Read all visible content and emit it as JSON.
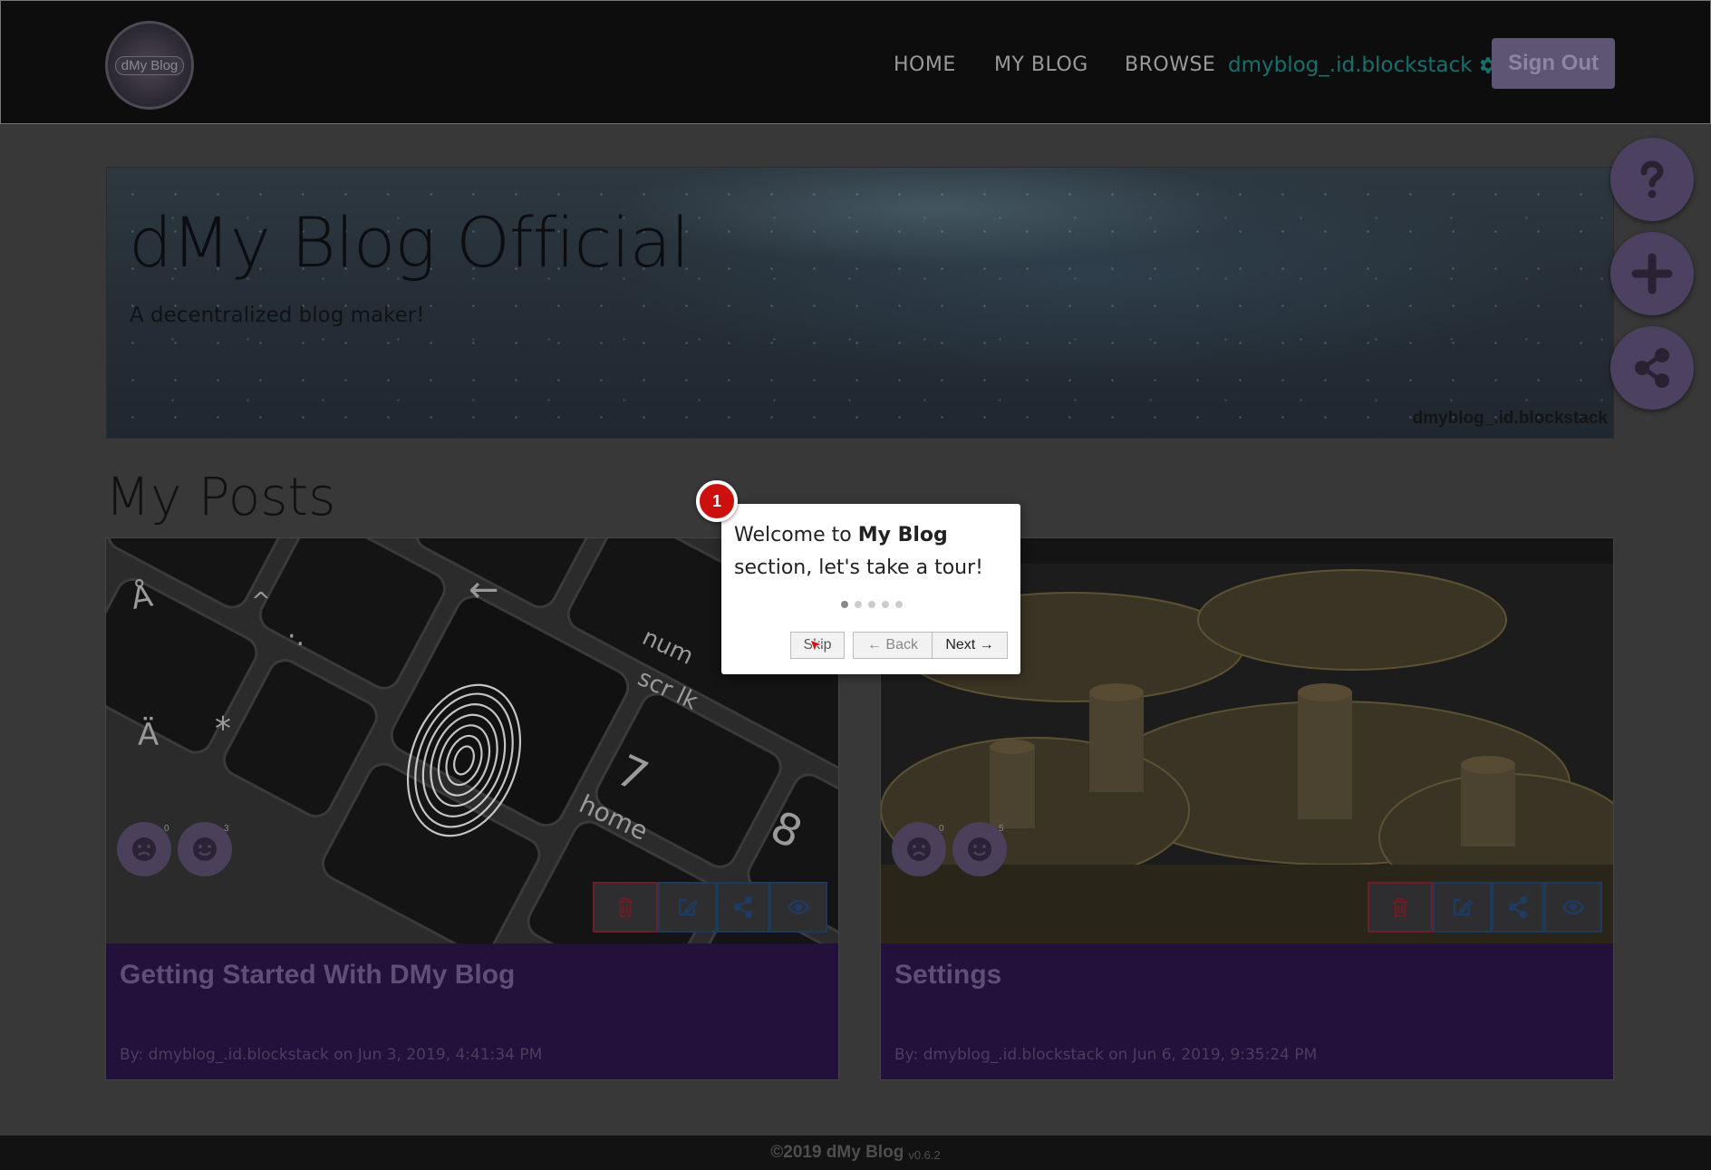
{
  "navbar": {
    "logo_text": "dMy Blog",
    "links": [
      "HOME",
      "MY BLOG",
      "BROWSE"
    ],
    "username": "dmyblog_.id.blockstack",
    "sign_out": "Sign Out"
  },
  "hero": {
    "title": "dMy Blog Official",
    "subtitle": "A decentralized blog maker!",
    "author": "dmyblog_.id.blockstack"
  },
  "fab": {
    "icons": [
      "question-icon",
      "plus-icon",
      "share-icon"
    ]
  },
  "posts": {
    "heading": "My Posts",
    "items": [
      {
        "title": "Getting Started With DMy Blog",
        "meta": "By: dmyblog_.id.blockstack on Jun 3, 2019, 4:41:34 PM",
        "sad_count": "0",
        "happy_count": "3",
        "image": "keyboard-fingerprint"
      },
      {
        "title": "Settings",
        "meta": "By: dmyblog_.id.blockstack on Jun 6, 2019, 9:35:24 PM",
        "sad_count": "0",
        "happy_count": "5",
        "image": "golden-gears"
      }
    ]
  },
  "tour": {
    "step": "1",
    "text_prefix": "Welcome to ",
    "text_bold": "My Blog",
    "text_suffix": " section, let's take a tour!",
    "dots_total": 5,
    "dots_active": 1,
    "skip": "Skip",
    "back": "← Back",
    "next": "Next →"
  },
  "footer": {
    "copyright": "©2019 dMy Blog",
    "version": "v0.6.2"
  },
  "colors": {
    "nav_bg": "#0d0d0d",
    "accent_purple": "#5e5473",
    "card_body": "#23103b",
    "username_teal": "#14706d",
    "tour_badge": "#cc0f0f"
  }
}
